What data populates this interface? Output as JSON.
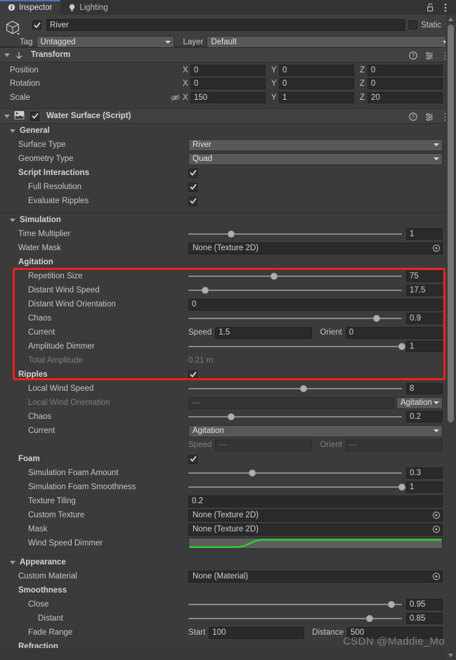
{
  "window": {
    "tabs": [
      {
        "label": "Inspector",
        "icon": "info-icon",
        "active": true
      },
      {
        "label": "Lighting",
        "icon": "bulb-icon",
        "active": false
      }
    ],
    "lock_icon": "lock-open-icon",
    "menu_icon": "kebab-menu-icon"
  },
  "object": {
    "icon": "gameobject-cube-icon",
    "enabled": true,
    "name": "River",
    "static_label": "Static",
    "static_checked": false,
    "tag_label": "Tag",
    "tag_value": "Untagged",
    "layer_label": "Layer",
    "layer_value": "Default"
  },
  "transform": {
    "title": "Transform",
    "icon": "transform-axes-icon",
    "help_icon": "help-icon",
    "preset_icon": "preset-icon",
    "menu_icon": "kebab-menu-icon",
    "rows": [
      {
        "label": "Position",
        "x": "0",
        "y": "0",
        "z": "0",
        "warn": false
      },
      {
        "label": "Rotation",
        "x": "0",
        "y": "0",
        "z": "0",
        "warn": false
      },
      {
        "label": "Scale",
        "x": "150",
        "y": "1",
        "z": "20",
        "warn": true,
        "warn_icon": "eye-off-icon"
      }
    ],
    "axis_labels": [
      "X",
      "Y",
      "Z"
    ]
  },
  "water_surface": {
    "title": "Water Surface (Script)",
    "icon": "script-water-icon",
    "enabled": true,
    "help_icon": "help-icon",
    "preset_icon": "preset-icon",
    "menu_icon": "kebab-menu-icon"
  },
  "general": {
    "title": "General",
    "surface_type_label": "Surface Type",
    "surface_type_value": "River",
    "geometry_type_label": "Geometry Type",
    "geometry_type_value": "Quad",
    "script_interactions_label": "Script Interactions",
    "script_interactions_checked": true,
    "full_resolution_label": "Full Resolution",
    "full_resolution_checked": true,
    "evaluate_ripples_label": "Evaluate Ripples",
    "evaluate_ripples_checked": true
  },
  "simulation": {
    "title": "Simulation",
    "time_multiplier_label": "Time Multiplier",
    "time_multiplier_value": "1",
    "time_multiplier_pct": 20,
    "water_mask_label": "Water Mask",
    "water_mask_value": "None (Texture 2D)"
  },
  "agitation": {
    "title": "Agitation",
    "repetition_size_label": "Repetition Size",
    "repetition_size_value": "75",
    "repetition_size_pct": 40,
    "distant_wind_speed_label": "Distant Wind Speed",
    "distant_wind_speed_value": "17.5",
    "distant_wind_speed_pct": 8,
    "distant_wind_orientation_label": "Distant Wind Orientation",
    "distant_wind_orientation_value": "0",
    "chaos_label": "Chaos",
    "chaos_value": "0.9",
    "chaos_pct": 88,
    "current_label": "Current",
    "current_speed_label": "Speed",
    "current_speed_value": "1.5",
    "current_orient_label": "Orient",
    "current_orient_value": "0",
    "amplitude_dimmer_label": "Amplitude Dimmer",
    "amplitude_dimmer_value": "1",
    "amplitude_dimmer_pct": 100,
    "total_amplitude_label": "Total Amplitude",
    "total_amplitude_value": "0.21 m"
  },
  "ripples": {
    "title": "Ripples",
    "enabled": true,
    "local_wind_speed_label": "Local Wind Speed",
    "local_wind_speed_value": "8",
    "local_wind_speed_pct": 54,
    "local_wind_orientation_label": "Local Wind Orientation",
    "local_wind_orientation_value": "—",
    "local_wind_orientation_mode": "Agitation",
    "chaos_label": "Chaos",
    "chaos_value": "0.2",
    "chaos_pct": 20,
    "current_label": "Current",
    "current_value": "Agitation",
    "current_speed_label": "Speed",
    "current_speed_value": "—",
    "current_orient_label": "Orient",
    "current_orient_value": "—"
  },
  "foam": {
    "title": "Foam",
    "enabled": true,
    "sim_foam_amount_label": "Simulation Foam Amount",
    "sim_foam_amount_value": "0.3",
    "sim_foam_amount_pct": 30,
    "sim_foam_smoothness_label": "Simulation Foam Smoothness",
    "sim_foam_smoothness_value": "1",
    "sim_foam_smoothness_pct": 100,
    "texture_tiling_label": "Texture Tiling",
    "texture_tiling_value": "0.2",
    "custom_texture_label": "Custom Texture",
    "custom_texture_value": "None (Texture 2D)",
    "mask_label": "Mask",
    "mask_value": "None (Texture 2D)",
    "wind_speed_dimmer_label": "Wind Speed Dimmer",
    "wind_speed_dimmer_curve_color": "#2bd32b"
  },
  "appearance": {
    "title": "Appearance",
    "custom_material_label": "Custom Material",
    "custom_material_value": "None (Material)",
    "smoothness_label": "Smoothness",
    "close_label": "Close",
    "close_value": "0.95",
    "close_pct": 95,
    "distant_label": "Distant",
    "distant_value": "0.85",
    "distant_pct": 85,
    "fade_range_label": "Fade Range",
    "fade_start_label": "Start",
    "fade_start_value": "100",
    "fade_distance_label": "Distance",
    "fade_distance_value": "500",
    "refraction_label": "Refraction"
  },
  "watermark": "CSDN @Maddie_Mo",
  "colors": {
    "accent_tab": "#4a76b8",
    "highlight_box": "#ef1f1f",
    "curve_green": "#2bd32b",
    "panel_bg": "#383838"
  }
}
